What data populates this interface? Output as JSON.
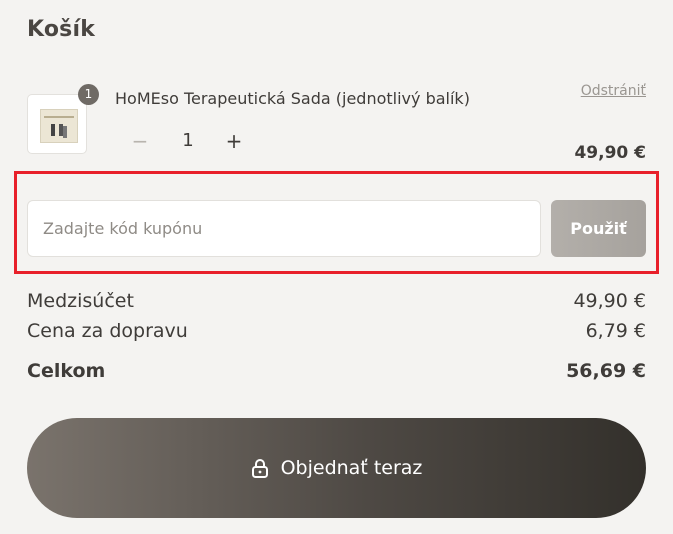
{
  "cart": {
    "title": "Košík"
  },
  "item": {
    "quantity_badge": "1",
    "name": "HoMEso Terapeutická Sada (jednotlivý balík)",
    "remove_label": "Odstrániť",
    "stepper": {
      "minus": "−",
      "value": "1",
      "plus": "+"
    },
    "price": "49,90 €"
  },
  "coupon": {
    "placeholder": "Zadajte kód kupónu",
    "value": "",
    "apply_label": "Použiť",
    "highlight_color": "#e8202a"
  },
  "summary": {
    "subtotal_label": "Medzisúčet",
    "subtotal_value": "49,90 €",
    "shipping_label": "Cena za dopravu",
    "shipping_value": "6,79 €",
    "total_label": "Celkom",
    "total_value": "56,69 €"
  },
  "checkout": {
    "icon": "lock-icon",
    "label": "Objednať teraz"
  }
}
